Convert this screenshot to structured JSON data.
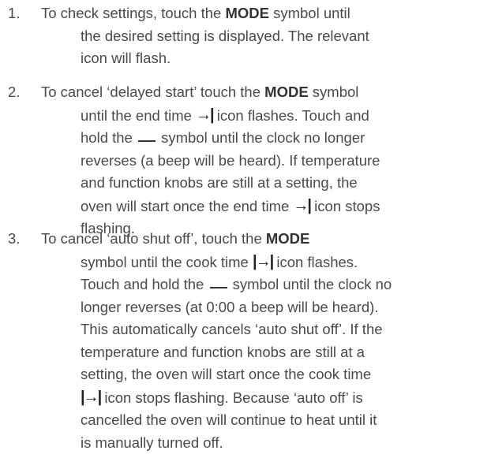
{
  "steps": [
    {
      "number": "1.",
      "line1": [
        "To check settings, touch the ",
        "MODE",
        " symbol until"
      ],
      "lines": [
        "the desired setting is displayed. The relevant",
        "icon will flash."
      ]
    },
    {
      "number": "2.",
      "line1": [
        "To cancel ‘delayed start’ touch the ",
        "MODE",
        " symbol"
      ],
      "l2a": "until the end time ",
      "l2b": " icon flashes. Touch and",
      "l3a": "hold the ",
      "l3b": " symbol until the clock no longer",
      "lines": [
        "reverses (a beep will be heard). If temperature",
        "and function knobs are still at a setting, the"
      ],
      "l6a": "oven will start once the end time ",
      "l6b": " icon stops",
      "l7": "flashing."
    },
    {
      "number": "3.",
      "line1": [
        "To cancel ‘auto shut off’, touch the ",
        "MODE"
      ],
      "l2a": "symbol until the cook time ",
      "l2b": " icon flashes.",
      "l3a": "Touch and hold the ",
      "l3b": " symbol until the clock no",
      "lines": [
        "longer reverses (at 0:00 a beep will be heard).",
        "This automatically cancels ‘auto shut off’. If the",
        "temperature and function knobs are still at a",
        "setting, the oven will start once the cook time"
      ],
      "l8b": " icon stops flashing. Because ‘auto off’ is",
      "lines2": [
        "cancelled the oven will continue to heat until it",
        "is manually turned off."
      ]
    }
  ],
  "icons": {
    "end_time": "end-time-icon",
    "cook_time": "cook-time-icon",
    "minus_symbol": "minus-symbol-icon"
  }
}
